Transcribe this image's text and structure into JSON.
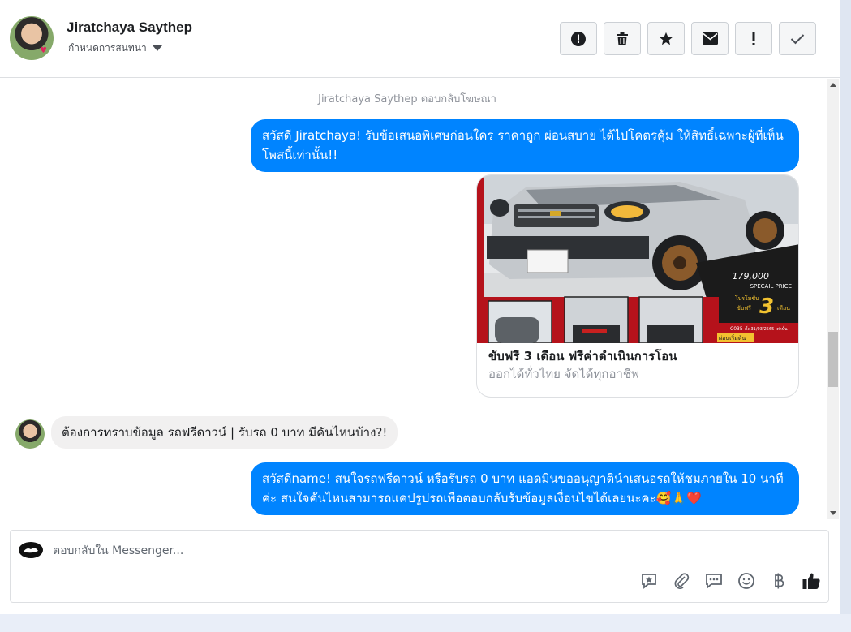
{
  "header": {
    "name": "Jiratchaya Saythep",
    "subtitle": "กำหนดการสนทนา",
    "tools": [
      {
        "name": "spam-button",
        "icon": "alert-circle-icon"
      },
      {
        "name": "delete-button",
        "icon": "trash-icon"
      },
      {
        "name": "star-button",
        "icon": "star-icon"
      },
      {
        "name": "mark-unread-button",
        "icon": "envelope-icon"
      },
      {
        "name": "follow-up-button",
        "icon": "exclamation-icon"
      },
      {
        "name": "done-button",
        "icon": "check-icon"
      }
    ]
  },
  "conversation": {
    "meta": "Jiratchaya Saythep ตอบกลับโฆษณา",
    "messages": {
      "ad_text": "สวัสดี Jiratchaya! รับข้อเสนอพิเศษก่อนใคร ราคาถูก ผ่อนสบาย ได้ไปโคตรคุ้ม ให้สิทธิ์เฉพาะผู้ที่เห็นโพสนี้เท่านั้น!!",
      "card": {
        "title": "ขับฟรี 3 เดือน ฟรีค่าดำเนินการโอน",
        "subtitle": "ออกได้ทั่วไทย จัดได้ทุกอาชีพ",
        "image": {
          "price": "179,000",
          "price_label": "SPECAIL PRICE",
          "promo_small": "โปรโมชั่น",
          "promo_free": "ขับฟรี",
          "promo_number": "3",
          "promo_month": "เดือน",
          "code": "C035",
          "code_date": "ตั้ง-31/03/2565 เท่านั้น",
          "bottom_tag": "ผ่อนเริ่มต้น"
        }
      },
      "incoming": "ต้องการทราบข้อมูล รถฟรีดาวน์ | รับรถ 0 บาท มีคันไหนบ้าง?!",
      "reply": "สวัสดีname! สนใจรถฟรีดาวน์ หรือรับรถ 0 บาท แอดมินขออนุญาตินำเสนอรถให้ชมภายใน 10 นาทีค่ะ สนใจคันไหนสามารถแคปรูปรถเพื่อตอบกลับรับข้อมูลเงื่อนไขได้เลยนะคะ🥰🙏❤️"
    }
  },
  "composer": {
    "placeholder": "ตอบกลับใน Messenger...",
    "icons": [
      "saved-reply-icon",
      "attach-icon",
      "chat-icon",
      "emoji-icon",
      "baht-icon",
      "like-icon"
    ]
  },
  "colors": {
    "accent": "#0084ff",
    "incoming_bubble": "#f1f0f0"
  }
}
